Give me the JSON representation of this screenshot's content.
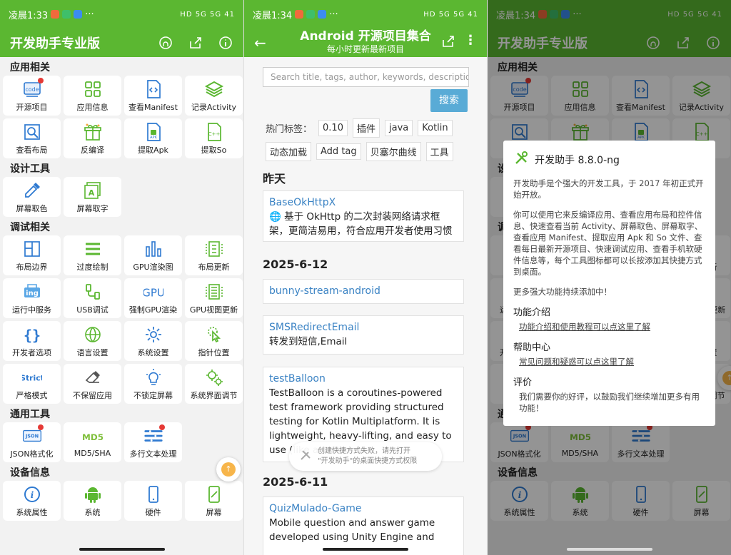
{
  "colors": {
    "accent": "#5bb731",
    "red_dot": "#e53935",
    "search_button": "#59abd6",
    "link": "#3b83c4"
  },
  "panel1": {
    "status": {
      "time": "凌晨1:33",
      "more": "···",
      "right": "HD 5G 5G 41"
    },
    "appbar": {
      "title": "开发助手专业版"
    },
    "sections": [
      {
        "title": "应用相关",
        "tiles": [
          {
            "label": "开源项目",
            "icon": "code-icon",
            "dot": true
          },
          {
            "label": "应用信息",
            "icon": "apps-grid-icon"
          },
          {
            "label": "查看Manifest",
            "icon": "manifest-icon"
          },
          {
            "label": "记录Activity",
            "icon": "layers-icon"
          },
          {
            "label": "查看布局",
            "icon": "layout-search-icon"
          },
          {
            "label": "反编译",
            "icon": "gift-box-icon"
          },
          {
            "label": "提取Apk",
            "icon": "apk-file-icon"
          },
          {
            "label": "提取So",
            "icon": "cpp-file-icon"
          }
        ]
      },
      {
        "title": "设计工具",
        "tiles": [
          {
            "label": "屏幕取色",
            "icon": "eyedropper-icon"
          },
          {
            "label": "屏幕取字",
            "icon": "text-capture-icon"
          }
        ]
      },
      {
        "title": "调试相关",
        "tiles": [
          {
            "label": "布局边界",
            "icon": "layout-bounds-icon"
          },
          {
            "label": "过度绘制",
            "icon": "overdraw-icon"
          },
          {
            "label": "GPU渲染图",
            "icon": "bar-chart-icon"
          },
          {
            "label": "布局更新",
            "icon": "layout-update-icon"
          },
          {
            "label": "运行中服务",
            "icon": "running-service-icon"
          },
          {
            "label": "USB调试",
            "icon": "usb-icon"
          },
          {
            "label": "强制GPU渲染",
            "icon": "gpu-icon"
          },
          {
            "label": "GPU视图更新",
            "icon": "gpu-view-update-icon"
          },
          {
            "label": "开发者选项",
            "icon": "braces-icon"
          },
          {
            "label": "语言设置",
            "icon": "globe-icon"
          },
          {
            "label": "系统设置",
            "icon": "gear-icon"
          },
          {
            "label": "指针位置",
            "icon": "pointer-icon"
          },
          {
            "label": "严格模式",
            "icon": "strict-icon"
          },
          {
            "label": "不保留应用",
            "icon": "eraser-icon"
          },
          {
            "label": "不锁定屏幕",
            "icon": "bulb-icon"
          },
          {
            "label": "系统界面调节",
            "icon": "gears-icon"
          }
        ]
      },
      {
        "title": "通用工具",
        "tiles": [
          {
            "label": "JSON格式化",
            "icon": "json-icon",
            "dot": true
          },
          {
            "label": "MD5/SHA",
            "icon": "md5-icon"
          },
          {
            "label": "多行文本处理",
            "icon": "multiline-text-icon",
            "dot": true
          }
        ]
      },
      {
        "title": "设备信息",
        "tiles": [
          {
            "label": "系统属性",
            "icon": "info-icon"
          },
          {
            "label": "系统",
            "icon": "android-icon"
          },
          {
            "label": "硬件",
            "icon": "phone-icon"
          },
          {
            "label": "屏幕",
            "icon": "screen-icon"
          }
        ]
      }
    ]
  },
  "panel2": {
    "status": {
      "time": "凌晨1:34",
      "more": "···",
      "right": "HD 5G 5G 41"
    },
    "appbar": {
      "title": "Android 开源项目集合",
      "subtitle": "每小时更新最新项目"
    },
    "search": {
      "placeholder": "Search title, tags, author, keywords, description",
      "button": "搜索"
    },
    "tags_label": "热门标签：",
    "tags_row1": [
      "0.10",
      "插件",
      "java",
      "Kotlin"
    ],
    "tags_row2": [
      "动态加载",
      "Add tag",
      "贝塞尔曲线",
      "工具"
    ],
    "groups": [
      {
        "date": "昨天",
        "items": [
          {
            "name": "BaseOkHttpX",
            "desc": "🌐 基于 OkHttp 的二次封装网络请求框架，更简洁易用，符合应用开发者使用习惯"
          }
        ]
      },
      {
        "date": "2025-6-12",
        "items": [
          {
            "name": "bunny-stream-android",
            "desc": ""
          },
          {
            "name": "SMSRedirectEmail",
            "desc": "转发到短信,Email"
          },
          {
            "name": "testBalloon",
            "desc": "TestBalloon is a coroutines-powered test framework providing structured testing for Kotlin Multiplatform. It is lightweight, heavy-lifting, and easy to use (like a balloon)."
          }
        ]
      },
      {
        "date": "2025-6-11",
        "items": [
          {
            "name": "QuizMulado-Game",
            "desc": "Mobile question and answer game developed using Unity Engine and"
          }
        ]
      }
    ],
    "toast": {
      "line1": "创建快捷方式失败，请先打开",
      "line2": "\"开发助手\"的桌面快捷方式权限"
    }
  },
  "panel3": {
    "status": {
      "time": "凌晨1:34",
      "more": "···",
      "right": "HD 5G 5G 41"
    },
    "appbar": {
      "title": "开发助手专业版"
    },
    "dialog": {
      "title": "开发助手 8.8.0-ng",
      "p1": "开发助手是个强大的开发工具，于 2017 年初正式开始开放。",
      "p2": "你可以使用它来反编译应用、查看应用布局和控件信息、快速查看当前 Activity、屏幕取色、屏幕取字、查看应用 Manifest、提取应用 Apk 和 So 文件、查看每日最新开源项目、快速调试应用、查看手机软硬件信息等，每个工具图标都可以长按添加其快捷方式到桌面。",
      "p3": "更多强大功能持续添加中！",
      "h_intro": "功能介绍",
      "l_intro": "功能介绍和使用教程可以点这里了解",
      "h_help": "帮助中心",
      "l_help": "常见问题和疑惑可以点这里了解",
      "h_rate": "评价",
      "l_rate": "我们需要你的好评，以鼓励我们继续增加更多有用功能！"
    }
  }
}
